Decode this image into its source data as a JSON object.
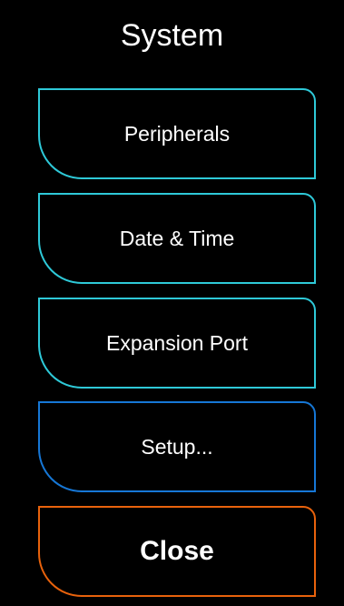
{
  "header": {
    "title": "System"
  },
  "menu": {
    "peripherals_label": "Peripherals",
    "datetime_label": "Date & Time",
    "expansion_label": "Expansion Port",
    "setup_label": "Setup...",
    "close_label": "Close"
  },
  "colors": {
    "background": "#000000",
    "primary_border": "#2ec9d8",
    "setup_border": "#1677d6",
    "close_border": "#e8620c",
    "text": "#ffffff"
  }
}
